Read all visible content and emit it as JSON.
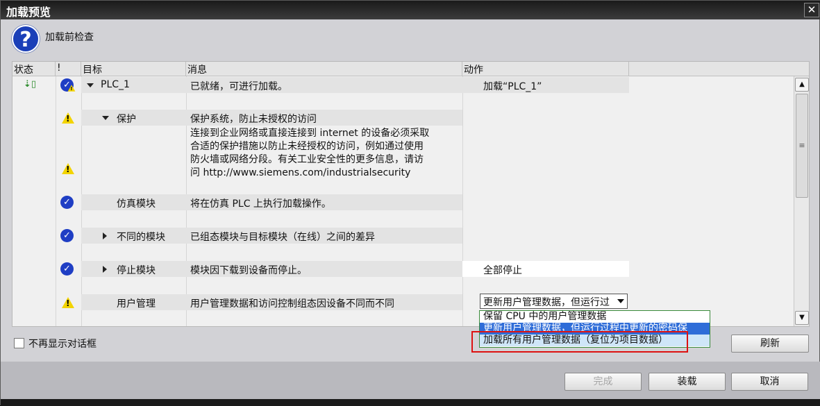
{
  "window": {
    "title": "加载预览",
    "close_glyph": "✕"
  },
  "header": {
    "text": "加载前检查",
    "icon": "question-icon"
  },
  "columns": {
    "status": "状态",
    "excl": "!",
    "target": "目标",
    "message": "消息",
    "action": "动作"
  },
  "rows": [
    {
      "target": "PLC_1",
      "message": "已就绪，可进行加载。",
      "action": "加载“PLC_1”"
    },
    {
      "target": "保护",
      "message": "保护系统，防止未授权的访问"
    },
    {
      "message_lines": [
        "连接到企业网络或直接连接到 internet 的设备必须采取",
        "合适的保护措施以防止未经授权的访问，例如通过使用",
        "防火墙或网络分段。有关工业安全性的更多信息，请访",
        "问 http://www.siemens.com/industrialsecurity"
      ]
    },
    {
      "target": "仿真模块",
      "message": "将在仿真 PLC 上执行加载操作。"
    },
    {
      "target": "不同的模块",
      "message": "已组态模块与目标模块（在线）之间的差异"
    },
    {
      "target": "停止模块",
      "message": "模块因下载到设备而停止。",
      "action": "全部停止"
    },
    {
      "target": "用户管理",
      "message": "用户管理数据和访问控制组态因设备不同而不同",
      "action": "更新用户管理数据，但运行过"
    }
  ],
  "dropdown": {
    "options": [
      "保留 CPU 中的用户管理数据",
      "更新用户管理数据，但运行过程中更新的密码保",
      "加载所有用户管理数据（复位为项目数据）"
    ]
  },
  "footer": {
    "checkbox_label": "不再显示对话框",
    "refresh": "刷新",
    "finish": "完成",
    "load": "装载",
    "cancel": "取消"
  },
  "colors": {
    "selected": "#2f6dd8",
    "highlight": "#cfe6f8",
    "warning": "#f3d400",
    "ok": "#1f3ec4",
    "annotation": "#d11111"
  }
}
